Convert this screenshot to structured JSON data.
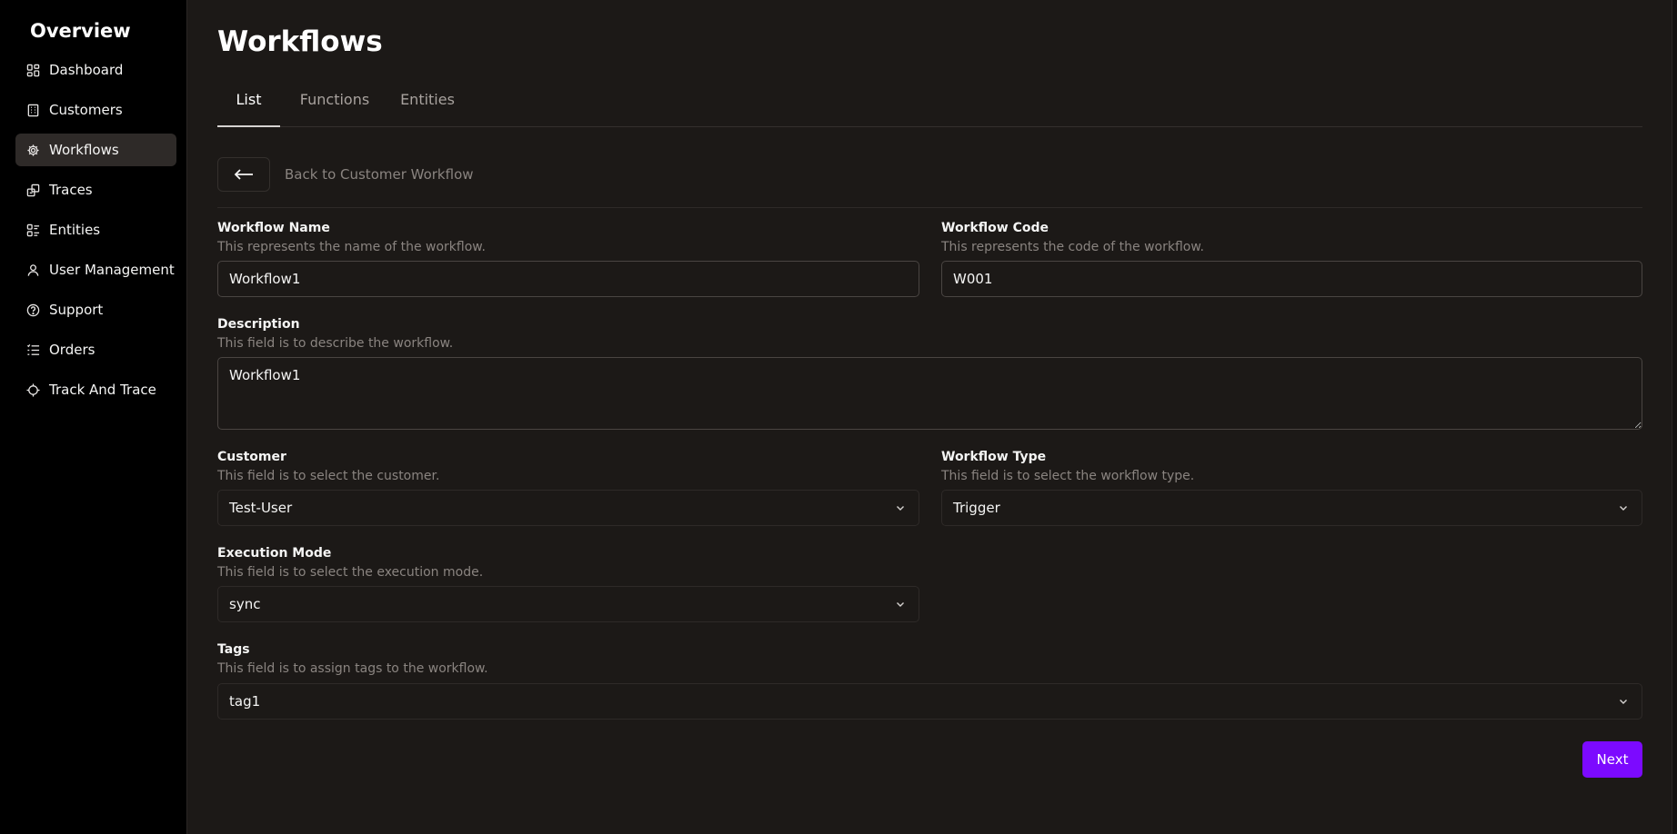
{
  "sidebar": {
    "title": "Overview",
    "items": [
      {
        "label": "Dashboard",
        "icon": "dashboard-icon"
      },
      {
        "label": "Customers",
        "icon": "building-icon"
      },
      {
        "label": "Workflows",
        "icon": "gear-icon",
        "active": true
      },
      {
        "label": "Traces",
        "icon": "traces-icon"
      },
      {
        "label": "Entities",
        "icon": "entities-icon"
      },
      {
        "label": "User Management",
        "icon": "user-icon"
      },
      {
        "label": "Support",
        "icon": "help-circle-icon"
      },
      {
        "label": "Orders",
        "icon": "list-icon"
      },
      {
        "label": "Track And Trace",
        "icon": "crosshair-icon"
      }
    ]
  },
  "header": {
    "title": "Workflows",
    "tabs": [
      {
        "label": "List",
        "active": true
      },
      {
        "label": "Functions"
      },
      {
        "label": "Entities"
      }
    ]
  },
  "back": {
    "icon": "arrow-left-icon",
    "label": "Back to Customer Workflow"
  },
  "form": {
    "workflow_name": {
      "label": "Workflow Name",
      "help": "This represents the name of the workflow.",
      "value": "Workflow1"
    },
    "workflow_code": {
      "label": "Workflow Code",
      "help": "This represents the code of the workflow.",
      "value": "W001"
    },
    "description": {
      "label": "Description",
      "help": "This field is to describe the workflow.",
      "value": "Workflow1"
    },
    "customer": {
      "label": "Customer",
      "help": "This field is to select the customer.",
      "value": "Test-User"
    },
    "workflow_type": {
      "label": "Workflow Type",
      "help": "This field is to select the workflow type.",
      "value": "Trigger"
    },
    "execution_mode": {
      "label": "Execution Mode",
      "help": "This field is to select the execution mode.",
      "value": "sync"
    },
    "tags": {
      "label": "Tags",
      "help": "This field is to assign tags to the workflow.",
      "value": "tag1"
    }
  },
  "actions": {
    "next_label": "Next"
  },
  "colors": {
    "accent": "#7c0aff",
    "background": "#1c1917",
    "sidebar": "#000000"
  }
}
